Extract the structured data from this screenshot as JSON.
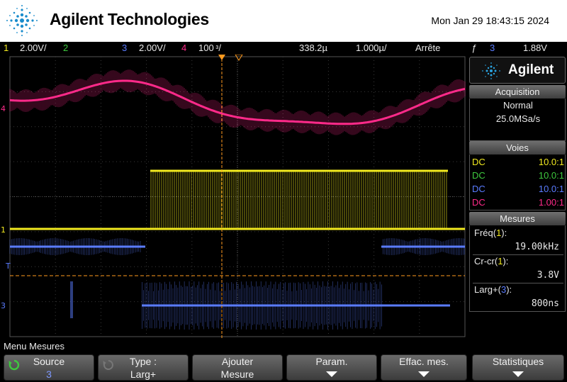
{
  "header": {
    "brand": "Agilent Technologies",
    "datetime": "Mon Jan 29 18:43:15 2024"
  },
  "status": {
    "ch1_num": "1",
    "ch1_scale": "2.00V/",
    "ch2_num": "2",
    "ch3_num": "3",
    "ch3_scale": "2.00V/",
    "ch4_num": "4",
    "ch4_scale": "100 ᶟ/",
    "timebase_delay": "338.2µ",
    "timebase_scale": "1.000µ/",
    "run_state": "Arrête",
    "trigger_symbol": "ƒ",
    "trigger_source": "3",
    "trigger_level": "1.88V"
  },
  "markers": {
    "ch4": "4",
    "ch1": "1",
    "trigger": "T",
    "ch3": "3"
  },
  "panel": {
    "brand": "Agilent",
    "acquisition": {
      "title": "Acquisition",
      "mode": "Normal",
      "rate": "25.0MSa/s"
    },
    "voies": {
      "title": "Voies",
      "rows": [
        {
          "coupling": "DC",
          "probe": "10.0:1",
          "color": "#f2ea1f"
        },
        {
          "coupling": "DC",
          "probe": "10.0:1",
          "color": "#3ec93e"
        },
        {
          "coupling": "DC",
          "probe": "10.0:1",
          "color": "#5a7cff"
        },
        {
          "coupling": "DC",
          "probe": "1.00:1",
          "color": "#ff2a8a"
        }
      ]
    },
    "mesures": {
      "title": "Mesures",
      "items": [
        {
          "label": "Fréq(",
          "src": "1",
          "close": "):",
          "value": "19.00kHz",
          "src_color": "#f2ea1f"
        },
        {
          "label": "Cr-cr(",
          "src": "1",
          "close": "):",
          "value": "3.8V",
          "src_color": "#f2ea1f"
        },
        {
          "label": "Larg+(",
          "src": "3",
          "close": "):",
          "value": "800ns",
          "src_color": "#5a7cff"
        }
      ]
    }
  },
  "menu": {
    "title": "Menu Mesures",
    "softkeys": [
      {
        "line1": "Source",
        "line2": "3"
      },
      {
        "line1": "Type :",
        "line2": "Larg+"
      },
      {
        "line1": "Ajouter",
        "line2": "Mesure"
      },
      {
        "line1": "Param."
      },
      {
        "line1": "Effac. mes."
      },
      {
        "line1": "Statistiques"
      }
    ]
  },
  "colors": {
    "ch1": "#f2ea1f",
    "ch2": "#3ec93e",
    "ch3": "#5a7cff",
    "ch4": "#ff2a8a",
    "cursor": "#ff9a1e"
  }
}
